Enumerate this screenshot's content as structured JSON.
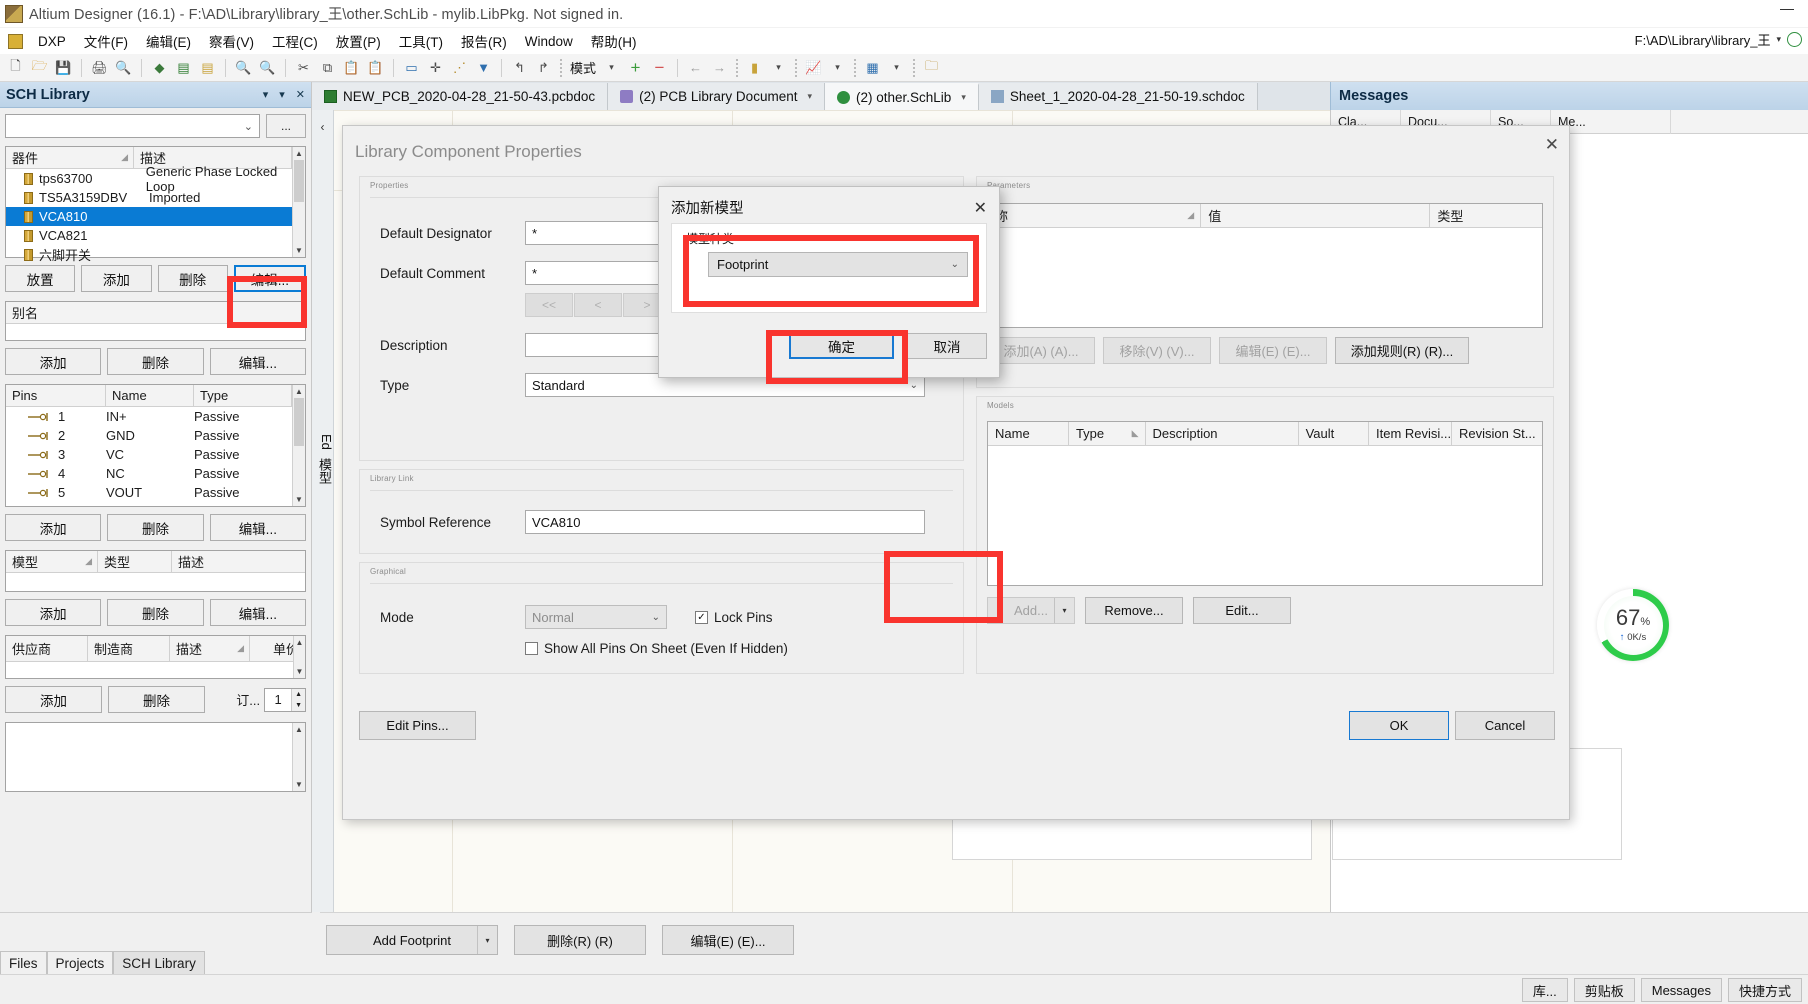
{
  "window": {
    "title": "Altium Designer (16.1) - F:\\AD\\Library\\library_王\\other.SchLib - mylib.LibPkg. Not signed in.",
    "minimize_label": "—"
  },
  "menubar": {
    "items": [
      {
        "label": "DXP"
      },
      {
        "label": "文件(F)"
      },
      {
        "label": "编辑(E)"
      },
      {
        "label": "察看(V)"
      },
      {
        "label": "工程(C)"
      },
      {
        "label": "放置(P)"
      },
      {
        "label": "工具(T)"
      },
      {
        "label": "报告(R)"
      },
      {
        "label": "Window"
      },
      {
        "label": "帮助(H)"
      }
    ],
    "right_path": "F:\\AD\\Library\\library_王",
    "caret": "▾"
  },
  "toolbar": {
    "mode_label": "模式",
    "mode_caret": "▾",
    "icons": [
      "new-document-icon",
      "open-folder-icon",
      "save-icon",
      "print-icon",
      "print-preview-icon",
      "3d-view-icon",
      "board-icon",
      "library-icon",
      "zoom-in-icon",
      "zoom-out-icon",
      "cut-icon",
      "copy-icon",
      "paste-icon",
      "paste-special-icon",
      "select-area-icon",
      "move-icon",
      "clear-selection-icon",
      "clear-filter-icon",
      "undo-icon",
      "redo-icon",
      "plus-icon",
      "minus-icon",
      "prev-icon",
      "next-icon",
      "component-icon",
      "chart-icon",
      "grid-icon",
      "snap-icon",
      "browse-icon"
    ]
  },
  "sch_library_panel": {
    "title": "SCH Library",
    "header_icons": [
      "pin-icon",
      "chevron-down-icon",
      "close-icon"
    ],
    "filter_value": "",
    "browse_button": "...",
    "components_grid": {
      "columns": [
        "器件",
        "描述"
      ],
      "rows": [
        {
          "name": "tps63700",
          "desc": "Generic Phase Locked Loop",
          "selected": false
        },
        {
          "name": "TS5A3159DBV",
          "desc": "Imported",
          "selected": false
        },
        {
          "name": "VCA810",
          "desc": "",
          "selected": true
        },
        {
          "name": "VCA821",
          "desc": "",
          "selected": false
        },
        {
          "name": "六脚开关",
          "desc": "",
          "selected": false
        }
      ]
    },
    "components_buttons": [
      "放置",
      "添加",
      "删除",
      "编辑..."
    ],
    "alias": {
      "column": "别名",
      "rows": [],
      "buttons": [
        "添加",
        "删除",
        "编辑..."
      ]
    },
    "pins": {
      "columns": [
        "Pins",
        "Name",
        "Type"
      ],
      "rows": [
        {
          "pin": "1",
          "name": "IN+",
          "type": "Passive"
        },
        {
          "pin": "2",
          "name": "GND",
          "type": "Passive"
        },
        {
          "pin": "3",
          "name": "VC",
          "type": "Passive"
        },
        {
          "pin": "4",
          "name": "NC",
          "type": "Passive"
        },
        {
          "pin": "5",
          "name": "VOUT",
          "type": "Passive"
        }
      ],
      "buttons": [
        "添加",
        "删除",
        "编辑..."
      ]
    },
    "models": {
      "columns": [
        "模型",
        "类型",
        "描述"
      ],
      "rows": [],
      "buttons": [
        "添加",
        "删除",
        "编辑..."
      ]
    },
    "suppliers": {
      "columns": [
        "供应商",
        "制造商",
        "描述",
        "单价"
      ],
      "rows": [],
      "buttons": [
        "添加",
        "删除"
      ],
      "order_label": "订...",
      "order_qty": "1"
    },
    "tabs": [
      {
        "label": "Files",
        "active": false
      },
      {
        "label": "Projects",
        "active": false
      },
      {
        "label": "SCH Library",
        "active": true
      }
    ]
  },
  "document_tabs": [
    {
      "label": "NEW_PCB_2020-04-28_21-50-43.pcbdoc",
      "icon": "pcb-icon",
      "active": false,
      "caret": false
    },
    {
      "label": "(2) PCB Library Document",
      "icon": "library-icon",
      "active": false,
      "caret": true
    },
    {
      "label": "(2) other.SchLib",
      "icon": "schlib-icon",
      "active": true,
      "caret": true
    },
    {
      "label": "Sheet_1_2020-04-28_21-50-19.schdoc",
      "icon": "schdoc-icon",
      "active": false,
      "caret": false
    }
  ],
  "messages_panel": {
    "title": "Messages",
    "columns": [
      "Cla...",
      "Docu...",
      "So...",
      "Me..."
    ]
  },
  "edge_strip": {
    "labels": [
      "Ed",
      "模型"
    ],
    "chevron": "‹"
  },
  "dialog": {
    "title": "Library Component Properties",
    "close_icon": "close-icon",
    "properties_group": {
      "caption": "Properties",
      "default_designator_label": "Default Designator",
      "default_designator_value": "*",
      "default_comment_label": "Default Comment",
      "default_comment_value": "*",
      "nav_buttons": [
        "<<",
        "<",
        ">",
        ">>"
      ],
      "description_label": "Description",
      "description_value": "",
      "type_label": "Type",
      "type_value": "Standard"
    },
    "library_link_group": {
      "caption": "Library Link",
      "symbol_reference_label": "Symbol Reference",
      "symbol_reference_value": "VCA810"
    },
    "graphical_group": {
      "caption": "Graphical",
      "mode_label": "Mode",
      "mode_value": "Normal",
      "lock_pins_label": "Lock Pins",
      "lock_pins_checked": true,
      "show_all_pins_label": "Show All Pins On Sheet (Even If Hidden)",
      "show_all_pins_checked": false
    },
    "parameters_group": {
      "caption": "Parameters",
      "columns": [
        "称",
        "值",
        "类型"
      ],
      "rows": [],
      "buttons": [
        {
          "label": "添加(A) (A)...",
          "disabled": true
        },
        {
          "label": "移除(V) (V)...",
          "disabled": true
        },
        {
          "label": "编辑(E) (E)...",
          "disabled": true
        },
        {
          "label": "添加规则(R) (R)...",
          "disabled": false
        }
      ]
    },
    "models_group": {
      "caption": "Models",
      "columns": [
        "Name",
        "Type",
        "Description",
        "Vault",
        "Item Revisi...",
        "Revision St..."
      ],
      "rows": [],
      "buttons": [
        {
          "label": "Add...",
          "disabled": true,
          "split": true
        },
        {
          "label": "Remove...",
          "disabled": false,
          "split": false
        },
        {
          "label": "Edit...",
          "disabled": false,
          "split": false
        }
      ]
    },
    "edit_pins_button": "Edit Pins...",
    "ok_button": "OK",
    "cancel_button": "Cancel"
  },
  "add_model_modal": {
    "title": "添加新模型",
    "close_icon": "close-icon",
    "group_caption": "模型种类",
    "selected_model_type": "Footprint",
    "dropdown_caret": "⌄",
    "ok_button": "确定",
    "cancel_button": "取消"
  },
  "progress": {
    "percent": "67",
    "percent_symbol": "%",
    "speed": "0K/s",
    "direction_icon": "upload-arrow-icon",
    "ring_color": "#2ecc4a"
  },
  "footer_toolbar": {
    "buttons": [
      {
        "label": "Add Footprint",
        "split": true
      },
      {
        "label": "删除(R) (R)",
        "split": false
      },
      {
        "label": "编辑(E) (E)...",
        "split": false
      }
    ]
  },
  "statusbar": {
    "buttons": [
      "库...",
      "剪贴板",
      "Messages",
      "快捷方式"
    ]
  },
  "colors": {
    "highlight_red": "#f9342e",
    "focus_blue": "#1879d2",
    "selection_blue": "#0a7bd4",
    "panel_header": "#bcd3e8"
  }
}
